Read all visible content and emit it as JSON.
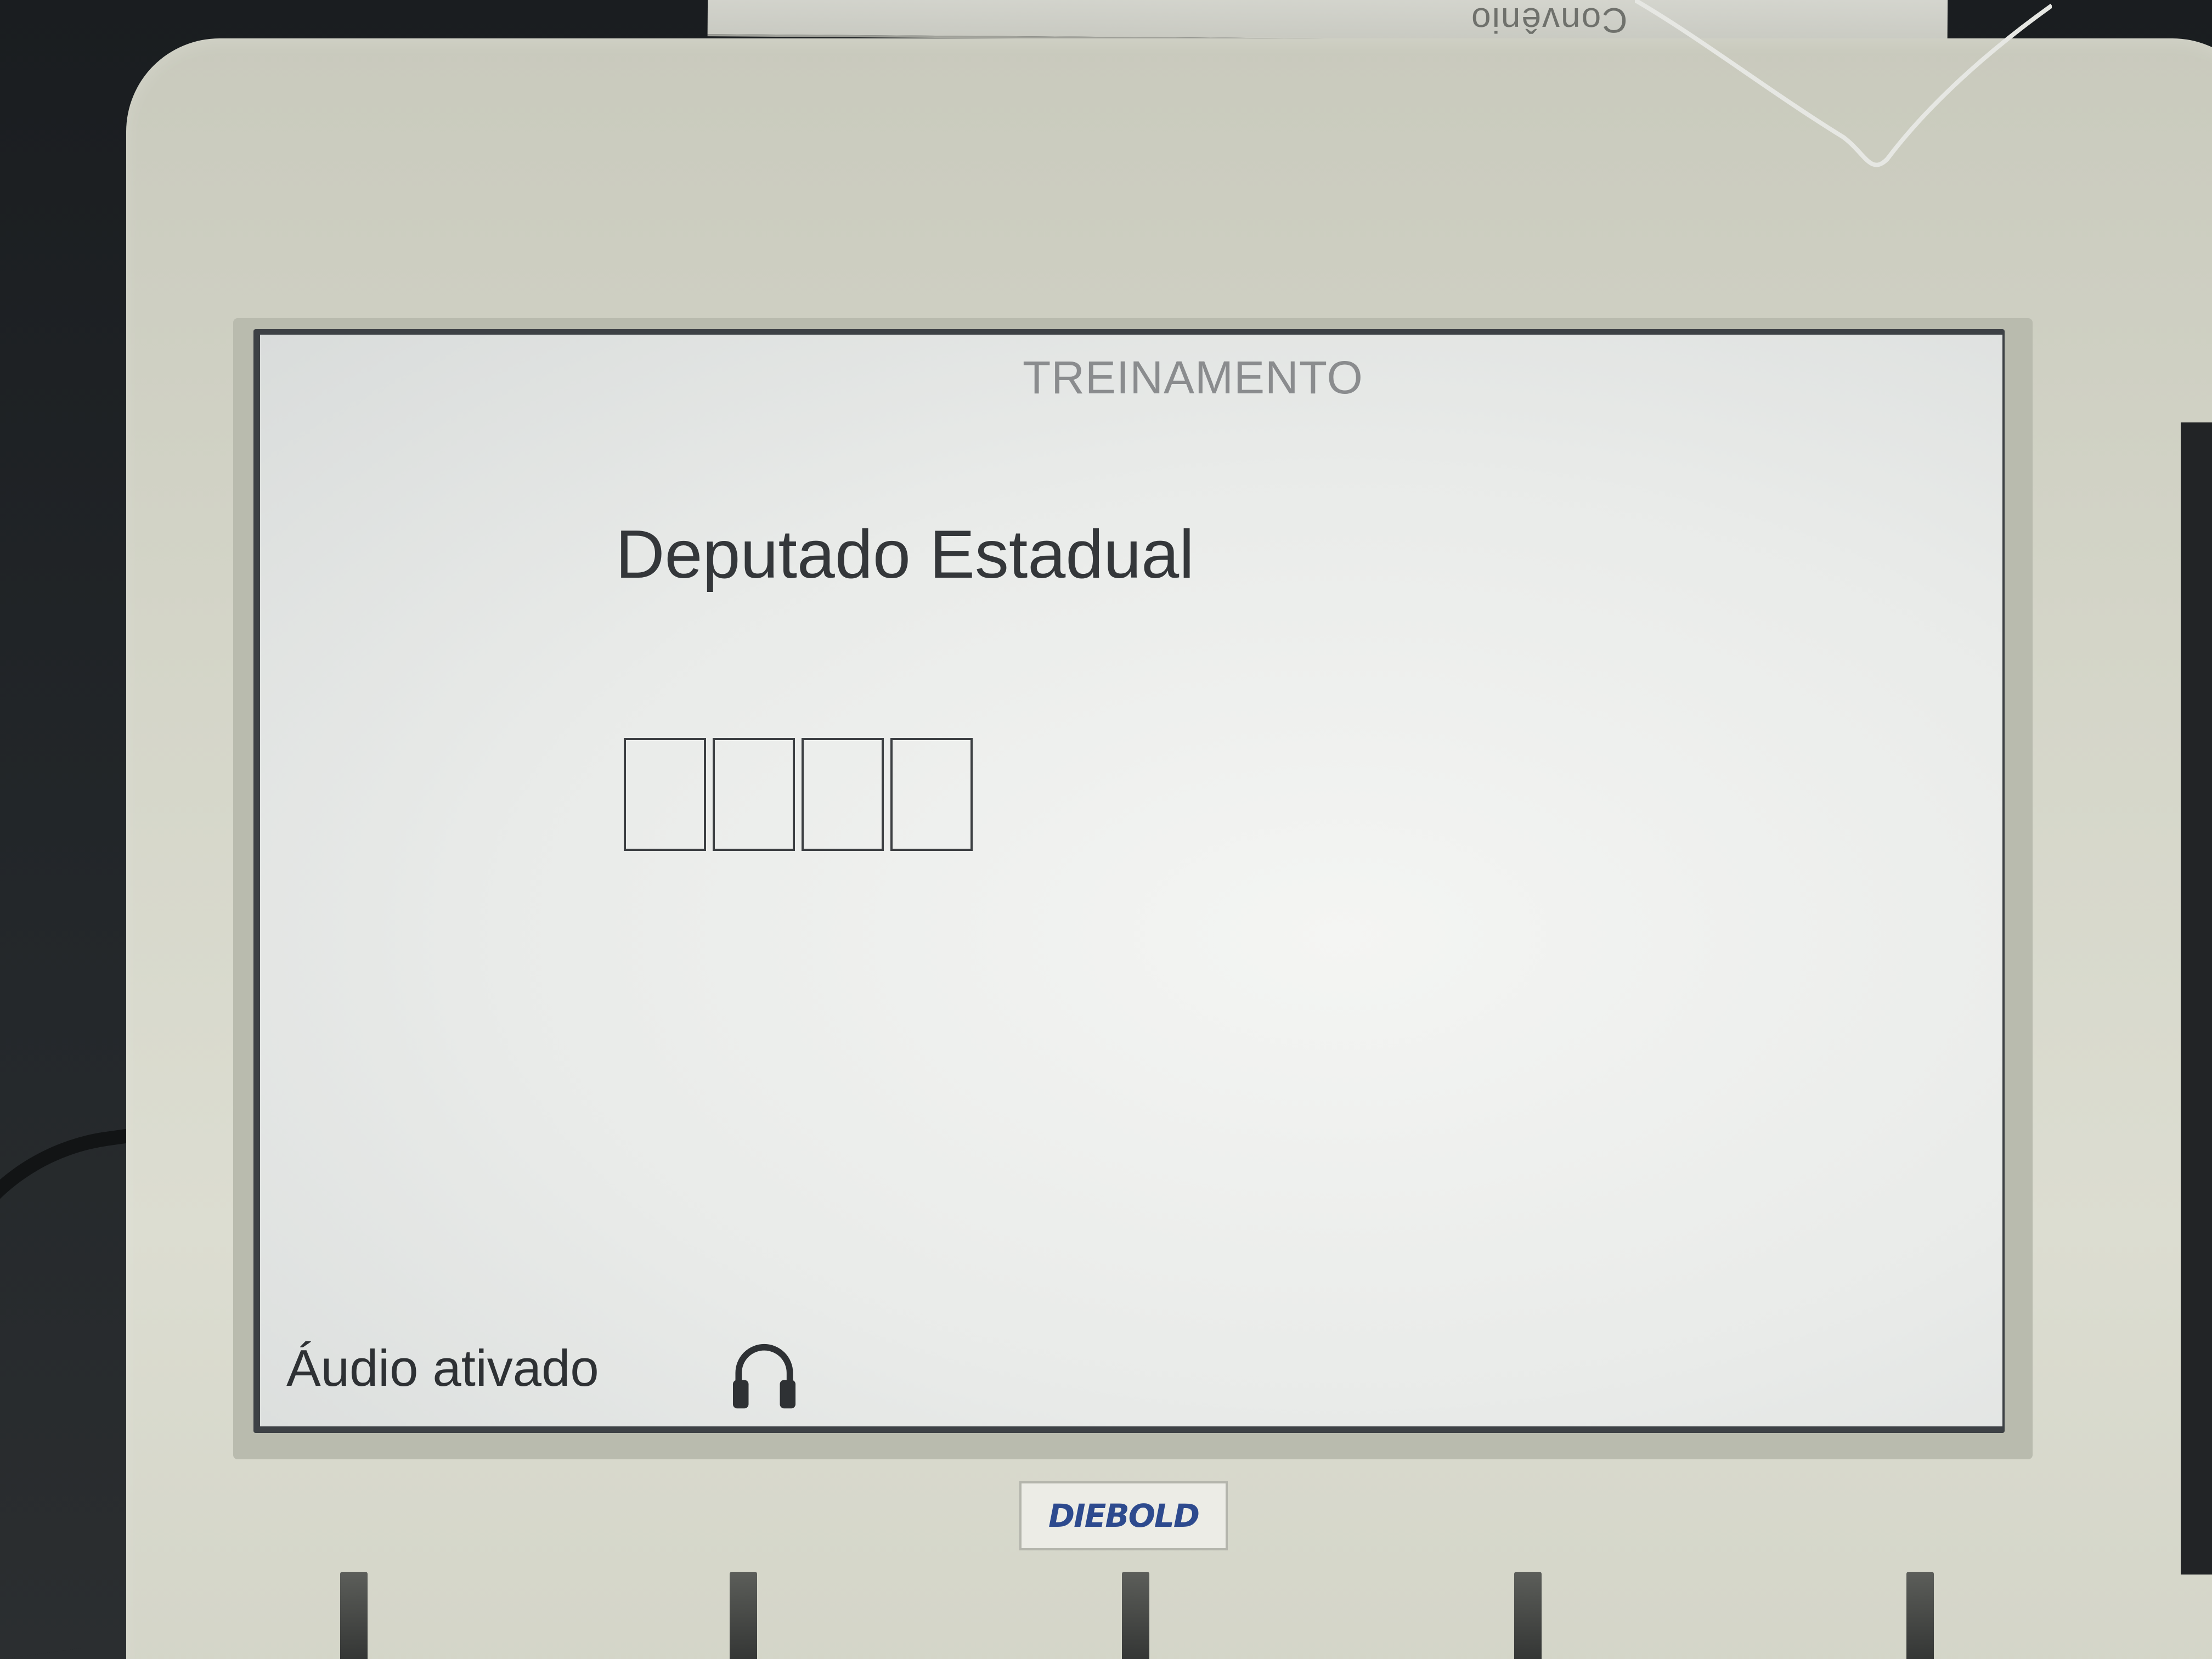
{
  "paper_label": "Convênio",
  "screen": {
    "mode_label": "TREINAMENTO",
    "office_title": "Deputado Estadual",
    "digit_slots": [
      "",
      "",
      "",
      ""
    ],
    "audio_status": "Áudio ativado",
    "audio_icon": "headphone-icon"
  },
  "brand": {
    "name": "DIEBOLD",
    "color": "#2d4a8e"
  }
}
